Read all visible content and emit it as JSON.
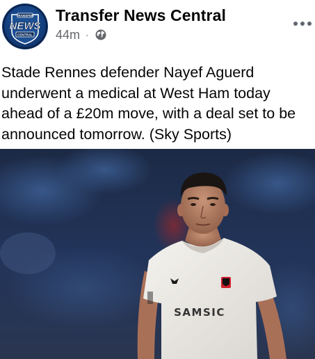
{
  "post": {
    "page_name": "Transfer News Central",
    "timestamp": "44m",
    "separator": "·",
    "privacy_icon": "globe-icon",
    "more_icon": "more-options-icon",
    "text": "Stade Rennes defender Nayef Aguerd underwent a medical at West Ham today ahead of a £20m move, with a deal set to be announced tomorrow. (Sky Sports)"
  },
  "avatar": {
    "logo_top": "TRANSFER",
    "logo_main": "NEWS",
    "logo_bottom": "CENTRAL"
  },
  "photo": {
    "kit_sponsor": "SAMSIC"
  },
  "colors": {
    "primary_text": "#050505",
    "secondary_text": "#65676b",
    "logo_blue": "#123b78"
  }
}
